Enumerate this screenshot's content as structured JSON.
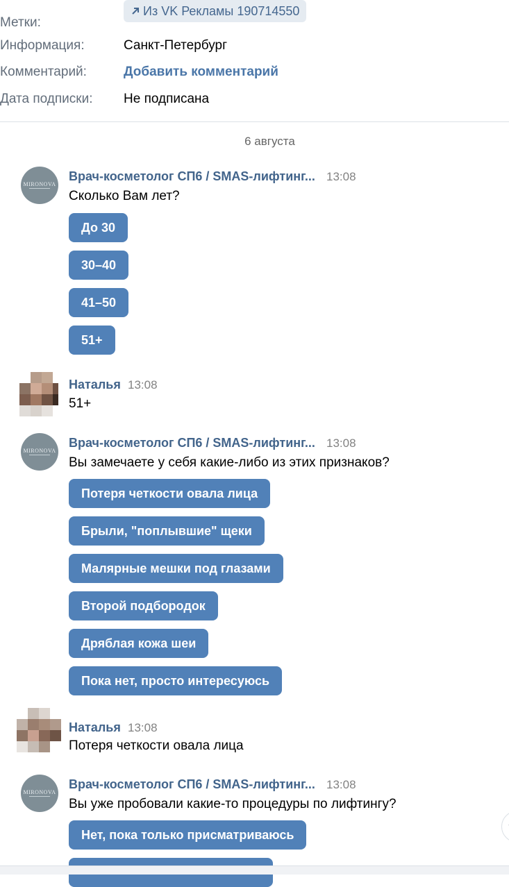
{
  "info": {
    "tags_label": "Метки:",
    "tag_value": "Из VK Рекламы 190714550",
    "info_label": "Информация:",
    "info_value": "Санкт-Петербург",
    "comment_label": "Комментарий:",
    "comment_link": "Добавить комментарий",
    "subscription_label": "Дата подписки:",
    "subscription_value": "Не подписана"
  },
  "date_separator": "6 августа",
  "messages": [
    {
      "sender": "Врач-косметолог СП6 / SMAS-лифтинг...",
      "time": "13:08",
      "text": "Сколько Вам лет?",
      "buttons": [
        "До 30",
        "30–40",
        "41–50",
        "51+"
      ]
    },
    {
      "sender": "Наталья",
      "time": "13:08",
      "text": "51+"
    },
    {
      "sender": "Врач-косметолог СП6 / SMAS-лифтинг...",
      "time": "13:08",
      "text": "Вы замечаете у себя какие-либо из этих признаков?",
      "buttons": [
        "Потеря четкости овала лица",
        "Брыли, \"поплывшие\" щеки",
        "Малярные мешки под глазами",
        "Второй подбородок",
        "Дряблая кожа шеи",
        "Пока нет, просто интересуюсь"
      ]
    },
    {
      "sender": "Наталья",
      "time": "13:08",
      "text": "Потеря четкости овала лица"
    },
    {
      "sender": "Врач-косметолог СП6 / SMAS-лифтинг...",
      "time": "13:08",
      "text": "Вы уже пробовали какие-то процедуры по лифтингу?",
      "buttons": [
        "Нет, пока только присматриваюсь"
      ]
    }
  ],
  "avatar_logo_text": "MIRONOVA",
  "colors": {
    "button_bg": "#5181b8",
    "sender": "#42648b",
    "link": "#4a76a8"
  },
  "icons": {
    "tag": "arrow-up-right-icon",
    "scroll": "chevron-down-icon"
  }
}
